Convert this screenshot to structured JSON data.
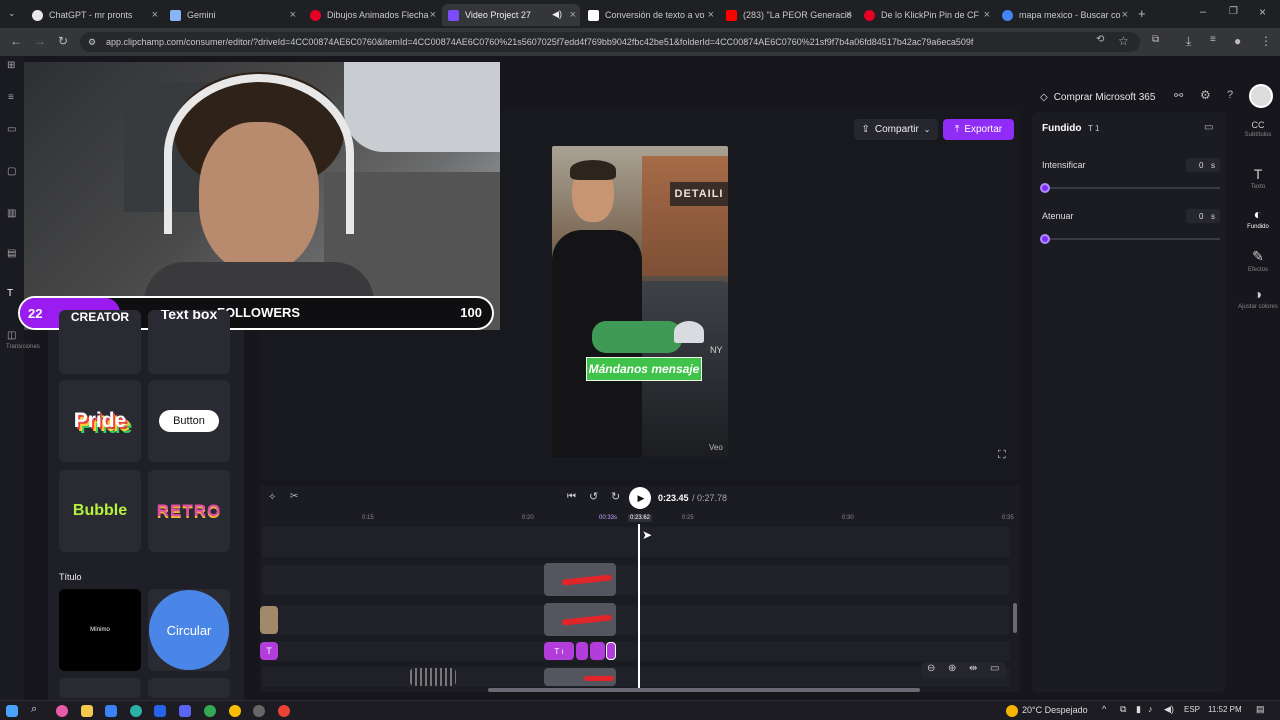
{
  "browser": {
    "tabs": [
      {
        "label": "ChatGPT - mr pronts",
        "color": "#e8e8e8"
      },
      {
        "label": "Gemini",
        "color": "#8ab4f8"
      },
      {
        "label": "Dibujos Animados Flecha",
        "color": "#e60023"
      },
      {
        "label": "Video Project 27",
        "color": "#7b4dff"
      },
      {
        "label": "Conversión de texto a vo",
        "color": "#ffffff"
      },
      {
        "label": "(283) \"La PEOR Generació",
        "color": "#ff0000"
      },
      {
        "label": "De lo KlickPin Pin de CF",
        "color": "#e60023"
      },
      {
        "label": "mapa mexico - Buscar co",
        "color": "#4285f4"
      }
    ],
    "url": "app.clipchamp.com/consumer/editor/?driveId=4CC00874AE6C0760&itemId=4CC00874AE6C0760%21s5607025f7edd4f769bb9042fbc42be51&folderId=4CC00874AE6C0760%21sf9f7b4a06fd84517b42ac79a6eca509f"
  },
  "header": {
    "buy_label": "Comprar Microsoft 365",
    "share_label": "Compartir",
    "export_label": "Exportar"
  },
  "left_rail": {
    "transitions_label": "Transiciones"
  },
  "webcam": {
    "followers_count": "22",
    "followers_label": "FOLLOWERS",
    "followers_goal": "100"
  },
  "panel": {
    "cards": [
      "CREATOR",
      "Text box",
      "Pride",
      "Button",
      "Bubble",
      "RETRO"
    ],
    "section_title": "Título",
    "title_cards": [
      "Mínimo",
      "Circular"
    ]
  },
  "preview": {
    "caption": "Mándanos mensaje",
    "sign_text": "DETAILI",
    "cap_text": "NY",
    "watermark": "Veo"
  },
  "right_panel": {
    "title": "Fundido",
    "layer_badge": "T 1",
    "fade_in_label": "Intensificar",
    "fade_in_value": "0",
    "fade_in_unit": "s",
    "fade_out_label": "Atenuar",
    "fade_out_value": "0",
    "fade_out_unit": "s"
  },
  "right_rail": [
    {
      "icon": "CC",
      "label": "Subtítulos"
    },
    {
      "icon": "T",
      "label": "Texto"
    },
    {
      "icon": "◐",
      "label": "Fundido"
    },
    {
      "icon": "✎",
      "label": "Efectos"
    },
    {
      "icon": "◑",
      "label": "Ajustar colores"
    }
  ],
  "timeline": {
    "current_time": "0:23.45",
    "total_time": "/ 0:27.78",
    "ruler": [
      "0:15",
      "0:20",
      "0:25",
      "0:30",
      "0:35"
    ],
    "marker_left": "00:33s",
    "marker_right": "0:23.62"
  },
  "taskbar": {
    "weather": "20°C  Despejado",
    "lang": "ESP",
    "time": "11:52 PM"
  },
  "colors": {
    "accent": "#7b2ff7",
    "export": "#8f2cf5",
    "caption_bg": "#3fc34a"
  }
}
